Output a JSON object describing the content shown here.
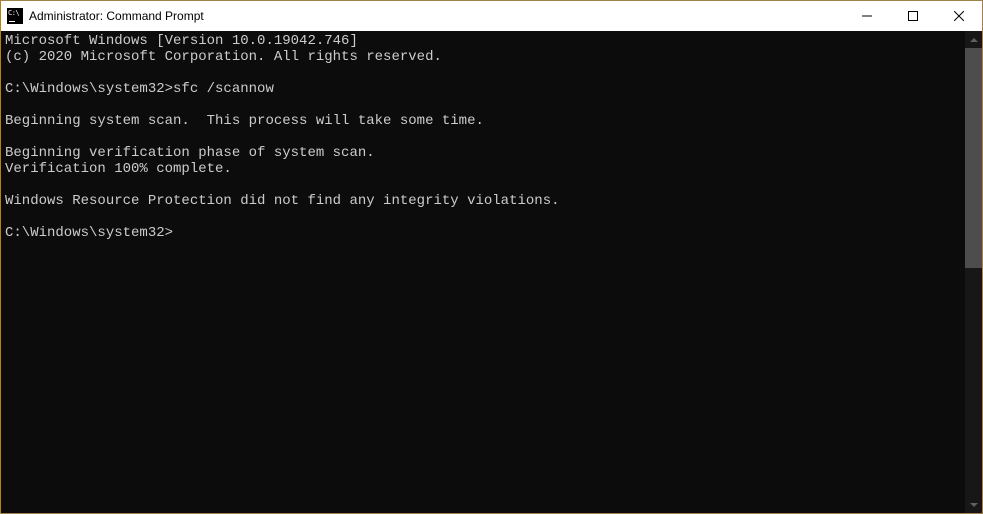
{
  "window": {
    "title": "Administrator: Command Prompt"
  },
  "terminal": {
    "lines": [
      "Microsoft Windows [Version 10.0.19042.746]",
      "(c) 2020 Microsoft Corporation. All rights reserved.",
      "",
      "C:\\Windows\\system32>sfc /scannow",
      "",
      "Beginning system scan.  This process will take some time.",
      "",
      "Beginning verification phase of system scan.",
      "Verification 100% complete.",
      "",
      "Windows Resource Protection did not find any integrity violations.",
      "",
      "C:\\Windows\\system32>"
    ]
  }
}
